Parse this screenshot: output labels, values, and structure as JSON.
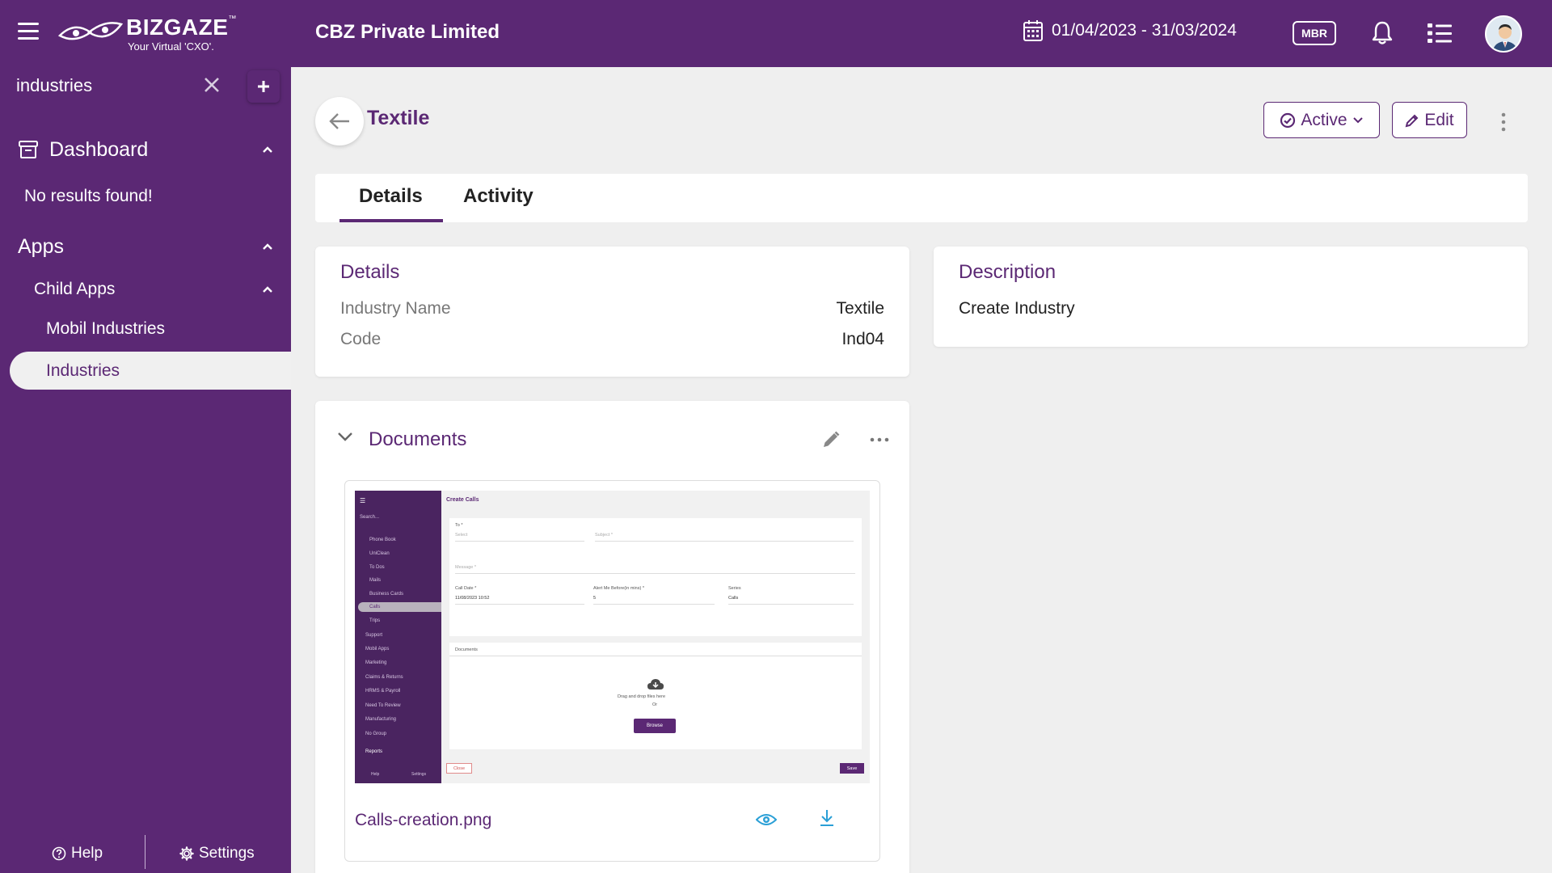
{
  "header": {
    "logo_text": "BIZGAZE",
    "logo_tm": "™",
    "logo_sub": "Your Virtual 'CXO'.",
    "company": "CBZ Private Limited",
    "date_range": "01/04/2023 - 31/03/2024",
    "mbr_label": "MBR",
    "colors": {
      "brand": "#5b2874",
      "background": "#efefef"
    }
  },
  "sidebar": {
    "search_value": "industries",
    "dashboard_label": "Dashboard",
    "no_results": "No results found!",
    "apps_label": "Apps",
    "child_apps_label": "Child Apps",
    "mobil_industries_label": "Mobil Industries",
    "industries_label": "Industries",
    "help_label": "Help",
    "settings_label": "Settings"
  },
  "page": {
    "title": "Textile",
    "status_label": "Active",
    "edit_label": "Edit",
    "tabs": [
      {
        "label": "Details",
        "active": true
      },
      {
        "label": "Activity",
        "active": false
      }
    ]
  },
  "details": {
    "title": "Details",
    "fields": [
      {
        "label": "Industry Name",
        "value": "Textile"
      },
      {
        "label": "Code",
        "value": "Ind04"
      }
    ]
  },
  "description": {
    "title": "Description",
    "text": "Create Industry"
  },
  "documents": {
    "title": "Documents",
    "files": [
      {
        "name": "Calls-creation.png"
      }
    ]
  },
  "thumbnail": {
    "title": "Create Calls",
    "search_placeholder": "Search...",
    "side_items": [
      "Phone Book",
      "UniClean",
      "To Dos",
      "Mails",
      "Business Cards",
      "Calls",
      "Trips",
      "Support",
      "Mobil Apps",
      "Marketing",
      "Claims & Returns",
      "HRMS & Payroll",
      "Need To Review",
      "Manufacturing",
      "No Group"
    ],
    "reports_label": "Reports",
    "help_label": "Help",
    "settings_label": "Settings",
    "to_label": "To *",
    "select_placeholder": "Select",
    "subject_placeholder": "Subject *",
    "message_placeholder": "Message *",
    "call_date_label": "Call Date *",
    "call_date_value": "11/08/2023 10:52",
    "alert_label": "Alert Me Before(in mins) *",
    "alert_value": "5",
    "series_label": "Series",
    "series_value": "Calls",
    "documents_label": "Documents",
    "drag_text": "Drag and drop files here",
    "or_text": "Or",
    "browse_label": "Browse",
    "close_label": "Close",
    "save_label": "Save"
  }
}
